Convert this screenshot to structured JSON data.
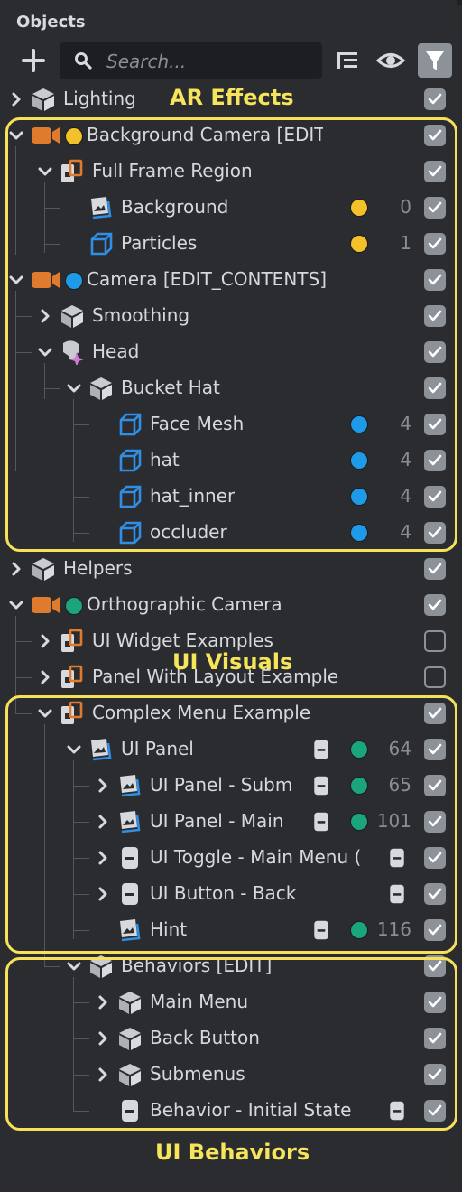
{
  "panel": {
    "title": "Objects"
  },
  "search": {
    "placeholder": "Search..."
  },
  "colors": {
    "yellow": "#f3c12a",
    "blue": "#1e9be8",
    "green": "#1aa57d",
    "camera": "#e07a2c",
    "highlight": "#f5e25a",
    "check": "#8d9198"
  },
  "rows": [
    {
      "label": "Lighting",
      "icon": "object-icon",
      "checked": true
    },
    {
      "label": "Background Camera [EDIT_CONTEN",
      "icon": "camera-icon",
      "checked": true
    },
    {
      "label": "Full Frame Region",
      "icon": "region-icon",
      "checked": true
    },
    {
      "label": "Background",
      "icon": "image-icon",
      "num": "0",
      "checked": true
    },
    {
      "label": "Particles",
      "icon": "mesh-icon",
      "num": "1",
      "checked": true
    },
    {
      "label": "Camera [EDIT_CONTENTS]",
      "icon": "camera-icon",
      "checked": true
    },
    {
      "label": "Smoothing",
      "icon": "object-icon",
      "checked": true
    },
    {
      "label": "Head",
      "icon": "head-icon",
      "checked": true
    },
    {
      "label": "Bucket Hat",
      "icon": "object-icon",
      "checked": true
    },
    {
      "label": "Face Mesh",
      "icon": "mesh-icon",
      "num": "4",
      "checked": true
    },
    {
      "label": "hat",
      "icon": "mesh-icon",
      "num": "4",
      "checked": true
    },
    {
      "label": "hat_inner",
      "icon": "mesh-icon",
      "num": "4",
      "checked": true
    },
    {
      "label": "occluder",
      "icon": "mesh-icon",
      "num": "4",
      "checked": true
    },
    {
      "label": "Helpers",
      "icon": "object-icon",
      "checked": true
    },
    {
      "label": "Orthographic Camera",
      "icon": "camera-icon",
      "checked": true
    },
    {
      "label": "UI Widget Examples",
      "icon": "region-icon",
      "checked": false
    },
    {
      "label": "Panel With Layout Example",
      "icon": "region-icon",
      "checked": false
    },
    {
      "label": "Complex Menu Example",
      "icon": "region-icon",
      "checked": true
    },
    {
      "label": "UI Panel",
      "icon": "image-icon",
      "num": "64",
      "checked": true
    },
    {
      "label": "UI Panel - Subm",
      "icon": "image-icon",
      "num": "65",
      "checked": true
    },
    {
      "label": "UI Panel - Main",
      "icon": "image-icon",
      "num": "101",
      "checked": true
    },
    {
      "label": "UI Toggle - Main Menu (",
      "icon": "script-icon",
      "checked": true
    },
    {
      "label": "UI Button - Back",
      "icon": "script-icon",
      "checked": true
    },
    {
      "label": "Hint",
      "icon": "image-icon",
      "num": "116",
      "checked": true
    },
    {
      "label": "Behaviors [EDIT]",
      "icon": "object-icon",
      "checked": true
    },
    {
      "label": "Main Menu",
      "icon": "object-icon",
      "checked": true
    },
    {
      "label": "Back Button",
      "icon": "object-icon",
      "checked": true
    },
    {
      "label": "Submenus",
      "icon": "object-icon",
      "checked": true
    },
    {
      "label": "Behavior - Initial State",
      "icon": "script-icon",
      "checked": true
    }
  ],
  "annotations": {
    "ar": "AR Effects",
    "visuals": "UI Visuals",
    "behaviors": "UI Behaviors"
  }
}
